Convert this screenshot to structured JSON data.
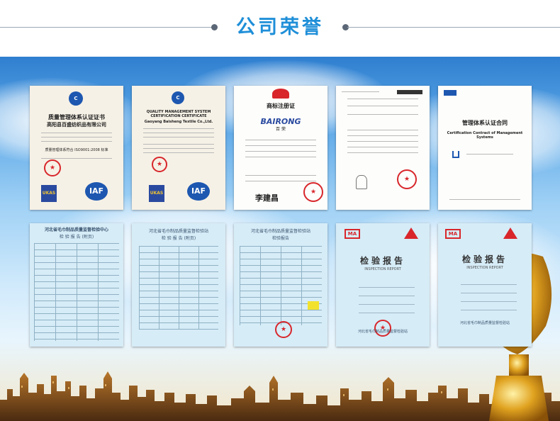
{
  "section": {
    "title": "公司荣誉"
  },
  "certificates_top": [
    {
      "id": "c1",
      "heading": "质量管理体系认证证书",
      "company": "高阳县百盛纺织品有限公司",
      "standard": "质量管理体系符合 ISO9001:2008 标准",
      "logo1": "UKAS",
      "logo2": "IAF"
    },
    {
      "id": "c2",
      "heading": "QUALITY MANAGEMENT SYSTEM CERTIFICATION CERTIFICATE",
      "company": "Gaoyang Baisheng Textile Co.,Ltd.",
      "logo1": "UKAS",
      "logo2": "IAF"
    },
    {
      "id": "c3",
      "heading": "商标注册证",
      "brand": "BAIRONG",
      "brand_sub": "百 荣",
      "signature": "李建昌"
    },
    {
      "id": "c4",
      "heading": "",
      "doc_type": "document"
    },
    {
      "id": "c5",
      "heading": "管理体系认证合同",
      "sub": "Certification Contract of Management Systems"
    }
  ],
  "reports_bottom": [
    {
      "id": "r1",
      "org": "河北省毛巾制品质量监督检验中心",
      "title": "检 验 报 告 (附页)"
    },
    {
      "id": "r2",
      "org": "河北省毛巾制品质量监督检验站",
      "title": "检 验 报 告 (附页)"
    },
    {
      "id": "r3",
      "org": "河北省毛巾制品质量监督检验站",
      "title": "检验报告"
    },
    {
      "id": "r4",
      "title": "检验报告",
      "sub": "INSPECTION REPORT",
      "mark": "MA",
      "footer": "河北省毛巾制品质量监督检验站"
    },
    {
      "id": "r5",
      "title": "检验报告",
      "sub": "INSPECTION REPORT",
      "mark": "MA",
      "footer": "河北省毛巾制品质量监督检验站"
    }
  ],
  "colors": {
    "title": "#1f8fd8",
    "seal": "#d8262b",
    "sky_top": "#2f7fd0"
  }
}
